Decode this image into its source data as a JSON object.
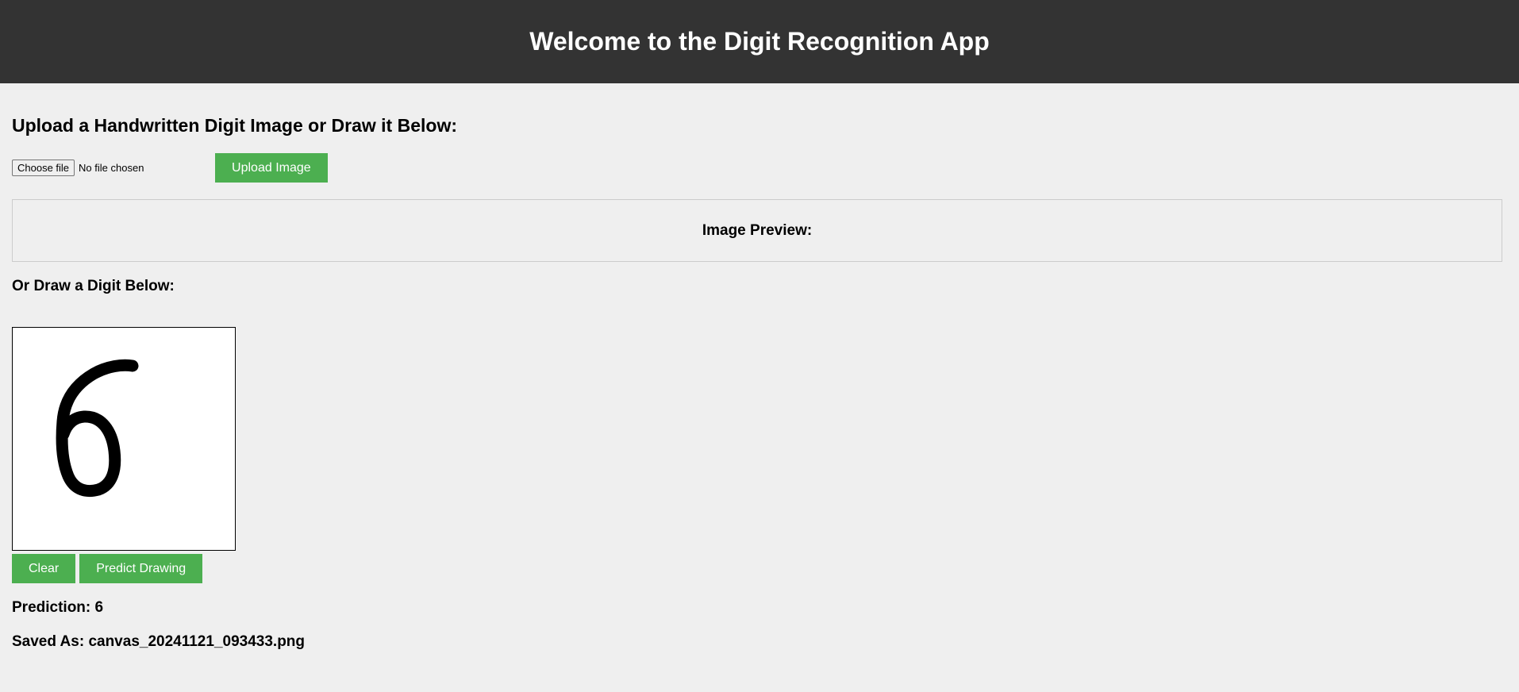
{
  "header": {
    "title": "Welcome to the Digit Recognition App"
  },
  "upload": {
    "heading": "Upload a Handwritten Digit Image or Draw it Below:",
    "choose_file_label": "Choose file",
    "no_file_text": "No file chosen",
    "upload_button_label": "Upload Image"
  },
  "preview": {
    "title": "Image Preview:"
  },
  "draw": {
    "heading": "Or Draw a Digit Below:",
    "drawn_digit": "6",
    "clear_label": "Clear",
    "predict_label": "Predict Drawing"
  },
  "result": {
    "prediction": "Prediction: 6",
    "saved_as": "Saved As: canvas_20241121_093433.png"
  },
  "colors": {
    "header_bg": "#333333",
    "page_bg": "#efefef",
    "button_green": "#4caf50"
  }
}
